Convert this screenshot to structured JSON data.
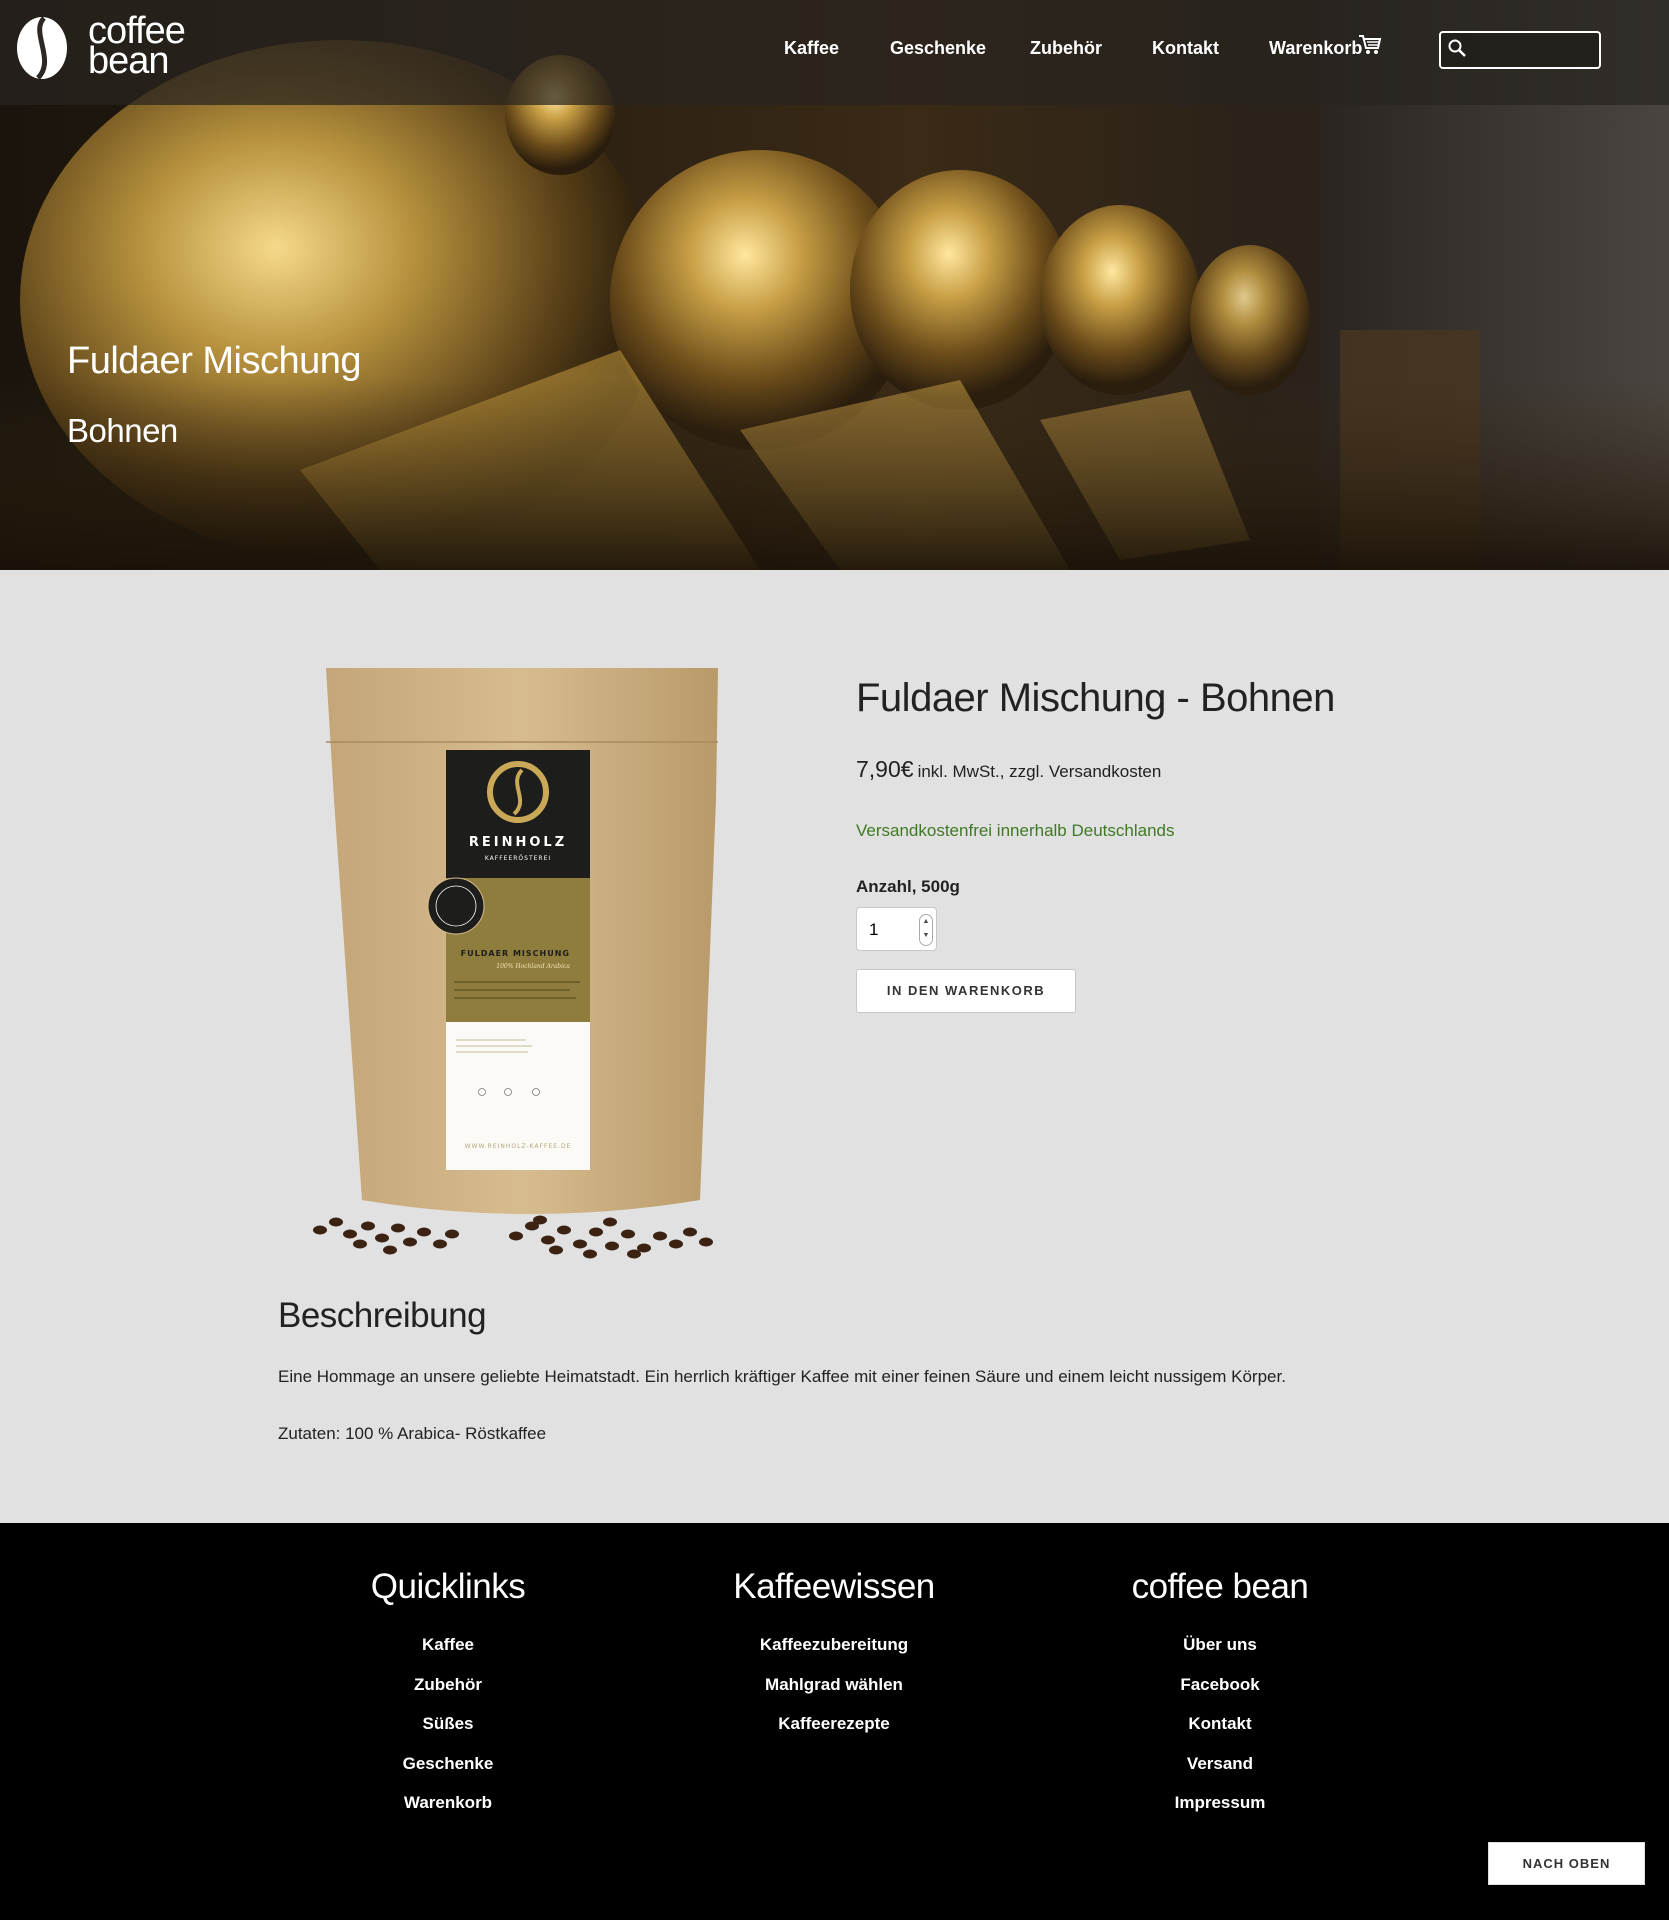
{
  "header": {
    "logo_line1": "coffee",
    "logo_line2": "bean",
    "nav": [
      "Kaffee",
      "Geschenke",
      "Zubehör",
      "Kontakt",
      "Warenkorb"
    ],
    "cart_icon": "shopping-cart-icon",
    "search": {
      "icon": "search-icon",
      "value": ""
    }
  },
  "hero": {
    "title": "Fuldaer Mischung",
    "subtitle": "Bohnen"
  },
  "product": {
    "image": {
      "brand": "REINHOLZ",
      "brand_sub": "KAFFEERÖSTEREI",
      "label": "FULDAER MISCHUNG",
      "label_sub": "100% Hochland Arabica",
      "url": "WWW.REINHOLZ-KAFFEE.DE"
    },
    "title": "Fuldaer Mischung - Bohnen",
    "price": "7,90€",
    "price_note": "inkl. MwSt., zzgl. Versandkosten",
    "shipping": "Versandkostenfrei innerhalb Deutschlands",
    "quantity_label": "Anzahl, 500g",
    "quantity": "1",
    "add_to_cart": "IN DEN WARENKORB"
  },
  "description": {
    "heading": "Beschreibung",
    "text": "Eine Hommage an unsere geliebte Heimatstadt. Ein herrlich kräftiger Kaffee mit einer feinen Säure und einem leicht nussigem Körper.",
    "ingredients": "Zutaten: 100 % Arabica- Röstkaffee"
  },
  "footer": {
    "columns": [
      {
        "title": "Quicklinks",
        "links": [
          "Kaffee",
          "Zubehör",
          "Süßes",
          "Geschenke",
          "Warenkorb"
        ]
      },
      {
        "title": "Kaffeewissen",
        "links": [
          "Kaffeezubereitung",
          "Mahlgrad wählen",
          "Kaffeerezepte"
        ]
      },
      {
        "title": "coffee bean",
        "links": [
          "Über uns",
          "Facebook",
          "Kontakt",
          "Versand",
          "Impressum"
        ]
      }
    ],
    "back_to_top": "NACH OBEN"
  },
  "colors": {
    "shipping_green": "#3e7a23",
    "footer_bg": "#000000",
    "content_bg": "#e1e1e1",
    "accent_gold": "#b8923e"
  }
}
